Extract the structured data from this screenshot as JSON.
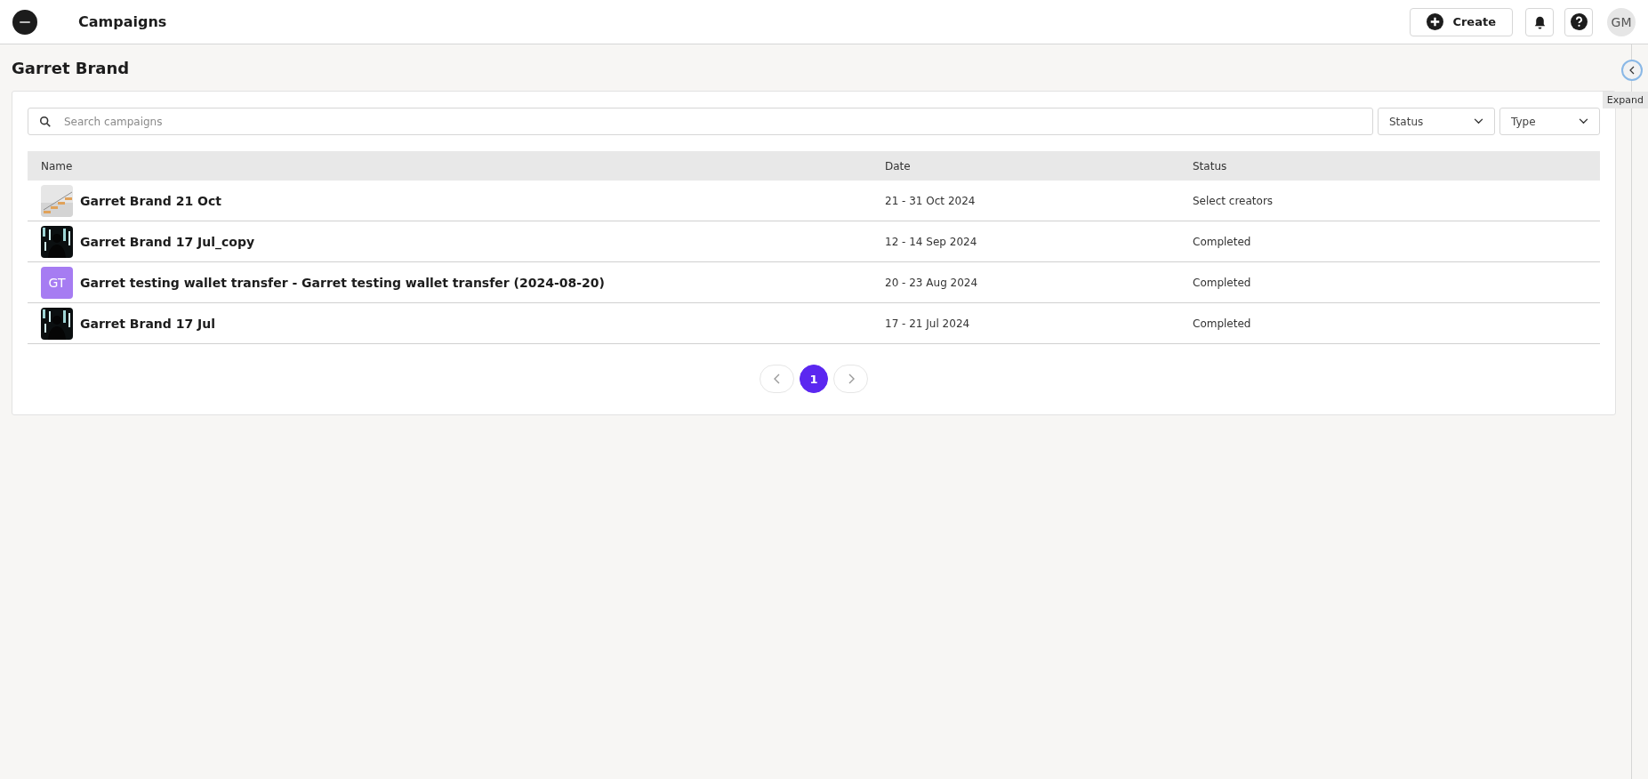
{
  "header": {
    "title": "Campaigns",
    "create_label": "Create",
    "avatar_initials": "GM"
  },
  "page": {
    "title": "Garret Brand"
  },
  "panel_toggle": {
    "tooltip": "Expand"
  },
  "search": {
    "placeholder": "Search campaigns"
  },
  "filters": [
    {
      "label": "Status"
    },
    {
      "label": "Type"
    }
  ],
  "table": {
    "columns": [
      "Name",
      "Date",
      "Status"
    ],
    "rows": [
      {
        "name": "Garret Brand 21 Oct",
        "date": "21 - 31 Oct 2024",
        "status": "Select creators"
      },
      {
        "name": "Garret Brand 17 Jul_copy",
        "date": "12 - 14 Sep 2024",
        "status": "Completed"
      },
      {
        "thumb": {
          "kind": "initials",
          "text": "GT",
          "color": "#a67cf2"
        },
        "name": "Garret testing wallet transfer - Garret testing wallet transfer (2024-08-20)",
        "date": "20 - 23 Aug 2024",
        "status": "Completed"
      },
      {
        "name": "Garret Brand 17 Jul",
        "date": "17 - 21 Jul 2024",
        "status": "Completed"
      }
    ]
  },
  "pagination": {
    "pages": [
      {
        "label": "1",
        "selected": true
      }
    ]
  }
}
